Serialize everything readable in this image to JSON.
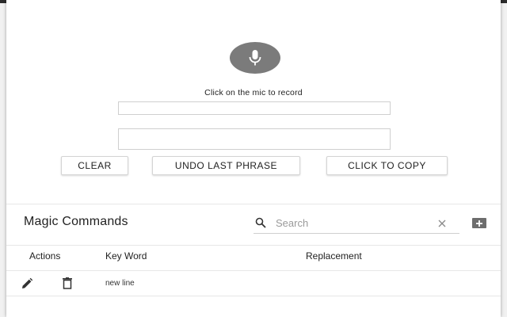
{
  "recorder": {
    "prompt": "Click on the mic to record",
    "transcript_value": "",
    "output_value": ""
  },
  "buttons": {
    "clear": "CLEAR",
    "undo": "UNDO LAST PHRASE",
    "copy": "CLICK TO COPY"
  },
  "magic_commands": {
    "title": "Magic Commands",
    "search_placeholder": "Search",
    "columns": [
      "Actions",
      "Key Word",
      "Replacement"
    ],
    "rows": [
      {
        "keyword": "new line",
        "replacement": ""
      }
    ]
  },
  "colors": {
    "mic_button": "#7b7b7b",
    "add_button": "#6d6d6d",
    "icon": "#333333"
  },
  "icons": {
    "mic": "microphone-icon",
    "search": "search-icon",
    "clear": "close-icon",
    "add": "plus-icon",
    "edit": "pencil-icon",
    "delete": "trash-icon"
  }
}
